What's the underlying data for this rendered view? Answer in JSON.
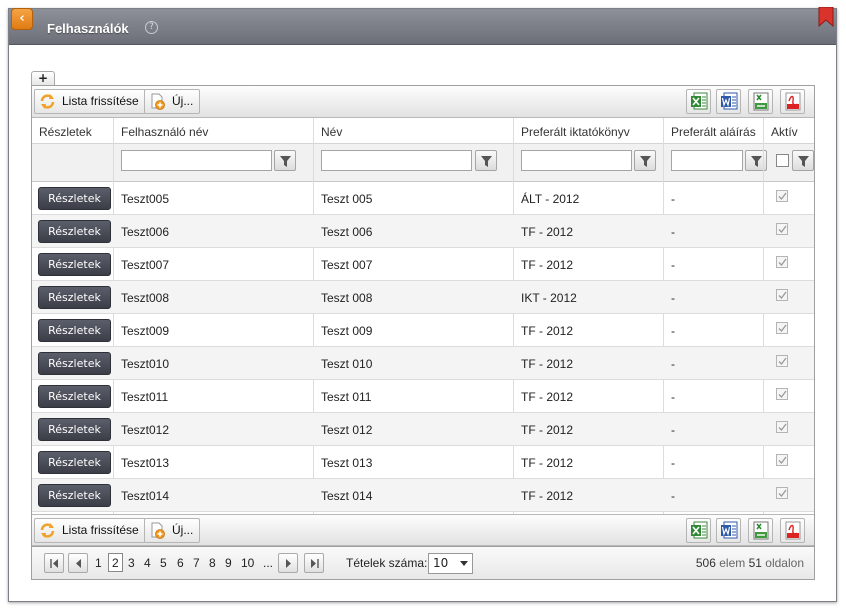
{
  "window": {
    "title": "Felhasználók",
    "help_symbol": "?",
    "back_symbol": "‹"
  },
  "add_tab": {
    "label": "+"
  },
  "toolbar": {
    "refresh_label": "Lista frissítése",
    "new_label": "Új...",
    "export_icons": [
      "excel-export-icon",
      "word-export-icon",
      "csv-export-icon",
      "pdf-export-icon"
    ]
  },
  "columns": {
    "details": "Részletek",
    "username": "Felhasználó név",
    "name": "Név",
    "registry": "Preferált iktatókönyv",
    "signature": "Preferált aláírás",
    "active": "Aktív"
  },
  "filters": {
    "username": "",
    "name": "",
    "registry": "",
    "signature": "",
    "active_checked": false
  },
  "rows": [
    {
      "button": "Részletek",
      "username": "Teszt005",
      "name": "Teszt 005",
      "registry": "ÁLT - 2012",
      "signature": "-",
      "active": true
    },
    {
      "button": "Részletek",
      "username": "Teszt006",
      "name": "Teszt 006",
      "registry": "TF - 2012",
      "signature": "-",
      "active": true
    },
    {
      "button": "Részletek",
      "username": "Teszt007",
      "name": "Teszt 007",
      "registry": "TF - 2012",
      "signature": "-",
      "active": true
    },
    {
      "button": "Részletek",
      "username": "Teszt008",
      "name": "Teszt 008",
      "registry": "IKT - 2012",
      "signature": "-",
      "active": true
    },
    {
      "button": "Részletek",
      "username": "Teszt009",
      "name": "Teszt 009",
      "registry": "TF - 2012",
      "signature": "-",
      "active": true
    },
    {
      "button": "Részletek",
      "username": "Teszt010",
      "name": "Teszt 010",
      "registry": "TF - 2012",
      "signature": "-",
      "active": true
    },
    {
      "button": "Részletek",
      "username": "Teszt011",
      "name": "Teszt 011",
      "registry": "TF - 2012",
      "signature": "-",
      "active": true
    },
    {
      "button": "Részletek",
      "username": "Teszt012",
      "name": "Teszt 012",
      "registry": "TF - 2012",
      "signature": "-",
      "active": true
    },
    {
      "button": "Részletek",
      "username": "Teszt013",
      "name": "Teszt 013",
      "registry": "TF - 2012",
      "signature": "-",
      "active": true
    },
    {
      "button": "Részletek",
      "username": "Teszt014",
      "name": "Teszt 014",
      "registry": "TF - 2012",
      "signature": "-",
      "active": true
    }
  ],
  "pager": {
    "pages": [
      "1",
      "2",
      "3",
      "4",
      "5",
      "6",
      "7",
      "8",
      "9",
      "10",
      "..."
    ],
    "current_page": "2",
    "page_size_label": "Tételek száma:",
    "page_size": "10",
    "total_items": "506",
    "items_word": "elem",
    "total_pages": "51",
    "pages_word": "oldalon"
  },
  "colors": {
    "accent_orange": "#e8861c",
    "titlebar": "#7a7d86",
    "row_button": "#474a54"
  }
}
